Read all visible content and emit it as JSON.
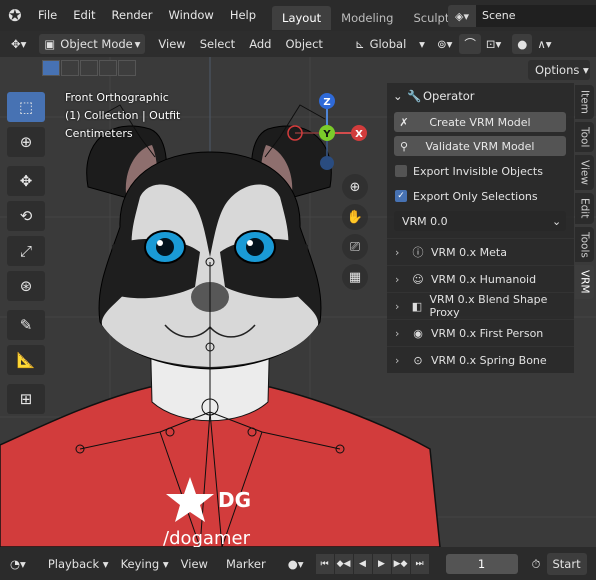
{
  "topbar": {
    "logo": "blender-logo",
    "menus": [
      "File",
      "Edit",
      "Render",
      "Window",
      "Help"
    ],
    "workspaces": [
      "Layout",
      "Modeling",
      "Sculpting"
    ],
    "active_workspace": "Layout",
    "scene": "Scene"
  },
  "header": {
    "mode": "Object Mode",
    "menus": [
      "View",
      "Select",
      "Add",
      "Object"
    ],
    "orientation": "Global",
    "options_label": "Options"
  },
  "viewport": {
    "info_lines": [
      "Front Orthographic",
      "(1) Collection | Outfit",
      "Centimeters"
    ],
    "gizmo_axes": {
      "z": "Z",
      "y": "Y",
      "x": "X"
    },
    "shirt_text_1": "DG",
    "shirt_text_2": "/dogamer",
    "colors": {
      "background": "#3a3a3a",
      "shirt": "#d23c3c",
      "active": "#4772b3"
    }
  },
  "npanel": {
    "section_title": "Operator",
    "buttons": [
      {
        "label": "Create VRM Model",
        "icon": "armature-icon"
      },
      {
        "label": "Validate VRM Model",
        "icon": "search-icon"
      }
    ],
    "checks": [
      {
        "label": "Export Invisible Objects",
        "checked": false
      },
      {
        "label": "Export Only Selections",
        "checked": true
      }
    ],
    "version": "VRM 0.0",
    "subpanels": [
      {
        "label": "VRM 0.x Meta",
        "icon": "info-icon"
      },
      {
        "label": "VRM 0.x Humanoid",
        "icon": "user-icon"
      },
      {
        "label": "VRM 0.x Blend Shape Proxy",
        "icon": "shape-icon"
      },
      {
        "label": "VRM 0.x First Person",
        "icon": "eye-icon"
      },
      {
        "label": "VRM 0.x Spring Bone",
        "icon": "physics-icon"
      }
    ]
  },
  "sidetabs": [
    "Item",
    "Tool",
    "View",
    "Edit",
    "Tools",
    "VRM"
  ],
  "active_sidetab": "VRM",
  "timeline": {
    "menus": [
      "Playback",
      "Keying",
      "View",
      "Marker"
    ],
    "frame": "1",
    "start_label": "Start"
  }
}
